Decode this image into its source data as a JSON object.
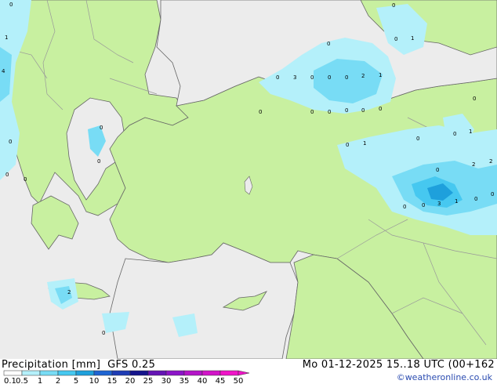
{
  "title": {
    "left": "Precipitation [mm]  GFS 0.25",
    "right": "Mo 01-12-2025 15..18 UTC (00+162"
  },
  "credit": "©weatheronline.co.uk",
  "colors": {
    "sea": "#ececec",
    "land": "#c8f0a0",
    "border": "#999999",
    "coast": "#555555"
  },
  "legend": {
    "labels": [
      "0.1",
      "0.5",
      "1",
      "2",
      "5",
      "10",
      "15",
      "20",
      "25",
      "30",
      "35",
      "40",
      "45",
      "50"
    ],
    "colors": [
      "#ffffff",
      "#b4f0fa",
      "#78dcf5",
      "#46c8f0",
      "#1ea0dc",
      "#1e64d2",
      "#1e3cb4",
      "#14148c",
      "#6414b4",
      "#8c14c8",
      "#b414c8",
      "#d214c8",
      "#f014c8"
    ]
  },
  "values": [
    "0",
    "1",
    "4",
    "0",
    "0",
    "0",
    "0",
    "0",
    "0",
    "0",
    "3",
    "0",
    "0",
    "0",
    "2",
    "1",
    "0",
    "0",
    "0",
    "0",
    "0",
    "0",
    "0",
    "0",
    "0",
    "1",
    "1",
    "0",
    "0",
    "2",
    "2",
    "0",
    "0",
    "0",
    "3",
    "1",
    "0",
    "0",
    "2",
    "0",
    "1",
    "0"
  ]
}
